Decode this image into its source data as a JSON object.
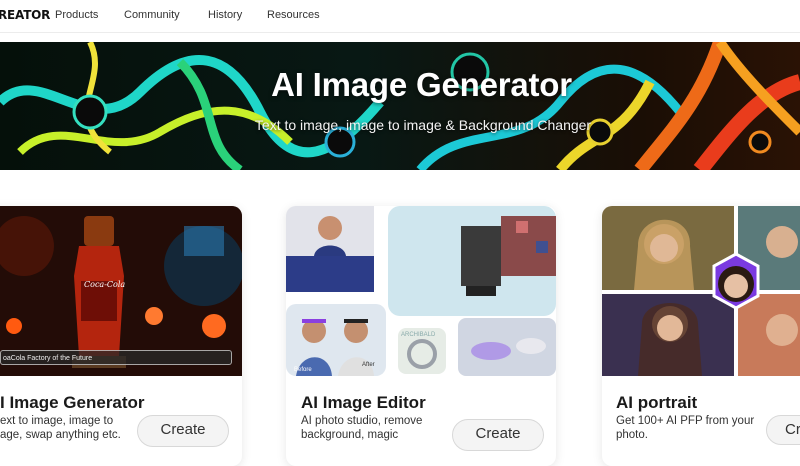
{
  "nav": {
    "logo": "REATOR",
    "items": [
      "Products",
      "Community",
      "History",
      "Resources"
    ]
  },
  "hero": {
    "title": "AI Image Generator",
    "subtitle": "Text to image, image to image & Background Changer"
  },
  "cards": [
    {
      "title": "I Image Generator",
      "desc_lines": [
        "ext to image, image to",
        "age, swap anything etc."
      ],
      "button": "Create",
      "image_caption": "oaCola Factory of the Future",
      "image_text": "Coca-Cola"
    },
    {
      "title": "AI Image Editor",
      "desc_lines": [
        "AI photo studio, remove",
        "background, magic"
      ],
      "button": "Create",
      "tags": [
        "Before",
        "After",
        "ARCHIBALD"
      ]
    },
    {
      "title": "AI portrait",
      "desc_lines": [
        "Get 100+ AI PFP from your",
        "photo."
      ],
      "button": "Cr"
    }
  ],
  "colors": {
    "nav_bg": "#ffffff",
    "hero_bg": "#0a0a0a",
    "button_bg": "#f4f4f4",
    "text": "#1a1a1a"
  }
}
